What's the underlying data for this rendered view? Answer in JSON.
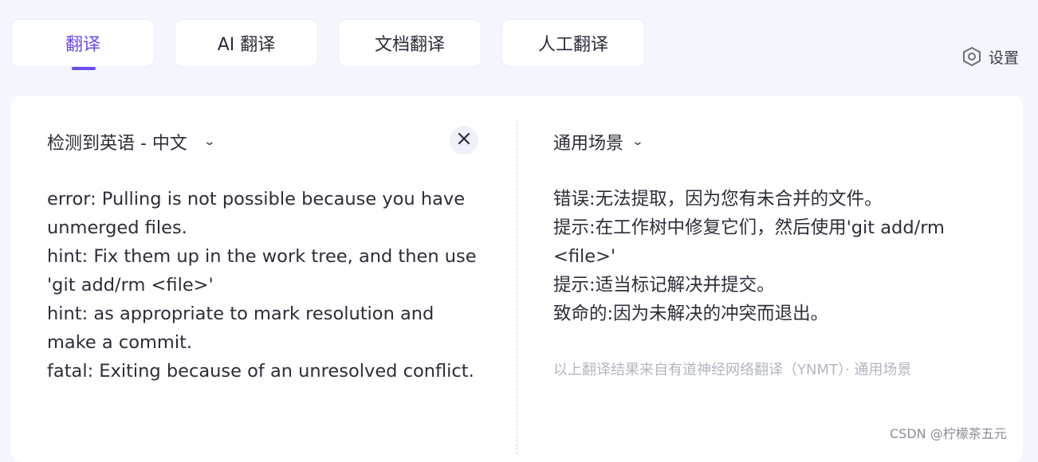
{
  "tabs": [
    {
      "label": "翻译",
      "active": true
    },
    {
      "label": "AI 翻译",
      "active": false
    },
    {
      "label": "文档翻译",
      "active": false
    },
    {
      "label": "人工翻译",
      "active": false
    }
  ],
  "settings": {
    "label": "设置",
    "icon": "hexagon-settings-icon"
  },
  "source": {
    "language_label": "检测到英语 - 中文",
    "lines": [
      "error: Pulling is not possible because you have",
      "unmerged files.",
      "hint: Fix them up in the work tree, and then use",
      "'git add/rm <file>'",
      "hint: as appropriate to mark resolution and",
      "make a commit.",
      "fatal: Exiting because of an unresolved conflict."
    ]
  },
  "target": {
    "scene_label": "通用场景",
    "lines": [
      "错误:无法提取，因为您有未合并的文件。",
      "提示:在工作树中修复它们，然后使用'git add/rm",
      "<file>'",
      "提示:适当标记解决并提交。",
      "致命的:因为未解决的冲突而退出。"
    ],
    "attribution": "以上翻译结果来自有道神经网络翻译（YNMT）· 通用场景"
  },
  "watermark": "CSDN @柠檬茶五元",
  "colors": {
    "accent": "#6d4bf2",
    "background": "#f3f6fc",
    "muted_text": "#b3b6c2"
  }
}
